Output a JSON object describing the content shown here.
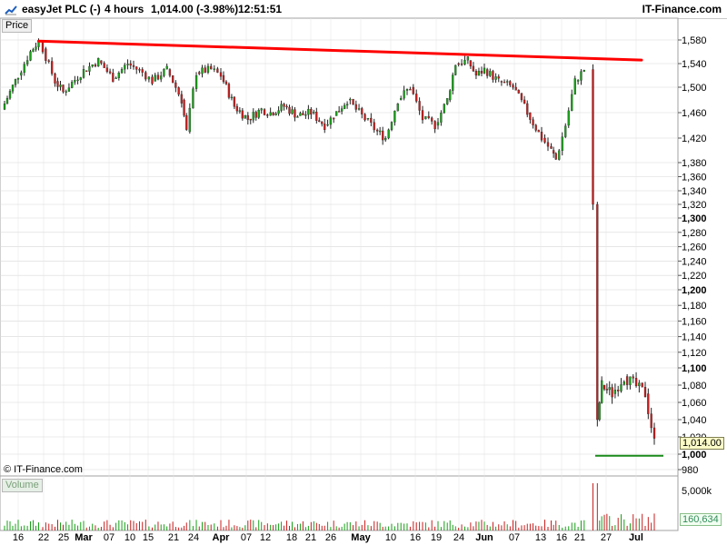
{
  "header": {
    "instrument": "easyJet PLC (-)",
    "timeframe": "4 hours",
    "quote": "1,014.00 (-3.98%)",
    "time": "12:51:51",
    "brand": "IT-Finance.com"
  },
  "labels": {
    "price_panel": "Price",
    "volume_panel": "Volume",
    "copyright": "© IT-Finance.com",
    "current_price": "1,014.00",
    "volume_scale_top": "5,000k",
    "current_volume": "160,634"
  },
  "colors": {
    "up": "#18a018",
    "down": "#c81e1e",
    "resistance": "#ff0000",
    "support": "#1a8a1a",
    "grid": "#d8d8d8",
    "text": "#000000"
  },
  "chart_data": {
    "type": "candlestick",
    "title": "easyJet PLC (-)",
    "timeframe": "4 hours",
    "y_axis": {
      "range": [
        975,
        1600
      ],
      "ticks": [
        980,
        1000,
        1020,
        1040,
        1060,
        1080,
        1100,
        1120,
        1140,
        1160,
        1180,
        1200,
        1220,
        1240,
        1260,
        1280,
        1300,
        1320,
        1340,
        1360,
        1380,
        1420,
        1460,
        1500,
        1540,
        1580
      ],
      "tick_labels": [
        "980",
        "1,000",
        "1,020",
        "1,040",
        "1,060",
        "1,080",
        "1,100",
        "1,120",
        "1,140",
        "1,160",
        "1,180",
        "1,200",
        "1,220",
        "1,240",
        "1,260",
        "1,280",
        "1,300",
        "1,320",
        "1,340",
        "1,360",
        "1,380",
        "1,420",
        "1,460",
        "1,500",
        "1,540",
        "1,580"
      ],
      "bold_ticks": [
        "1,000",
        "1,100",
        "1,200",
        "1,300"
      ]
    },
    "x_axis": {
      "tick_labels": [
        "16",
        "22",
        "25",
        "Mar",
        "07",
        "10",
        "15",
        "21",
        "24",
        "Apr",
        "07",
        "12",
        "18",
        "21",
        "26",
        "May",
        "10",
        "16",
        "19",
        "24",
        "Jun",
        "07",
        "13",
        "16",
        "21",
        "27",
        "Jul"
      ],
      "bold_ticks": [
        "Mar",
        "Apr",
        "May",
        "Jun",
        "Jul"
      ]
    },
    "price_path": [
      {
        "date": "Feb 14",
        "close": 1465
      },
      {
        "date": "Feb 16",
        "close": 1520
      },
      {
        "date": "Feb 19",
        "close": 1560
      },
      {
        "date": "Feb 21",
        "close": 1578
      },
      {
        "date": "Feb 22",
        "close": 1565
      },
      {
        "date": "Feb 25",
        "close": 1510
      },
      {
        "date": "Feb 27",
        "close": 1492
      },
      {
        "date": "Mar 01",
        "close": 1528
      },
      {
        "date": "Mar 04",
        "close": 1545
      },
      {
        "date": "Mar 07",
        "close": 1515
      },
      {
        "date": "Mar 10",
        "close": 1540
      },
      {
        "date": "Mar 13",
        "close": 1525
      },
      {
        "date": "Mar 15",
        "close": 1510
      },
      {
        "date": "Mar 18",
        "close": 1530
      },
      {
        "date": "Mar 21",
        "close": 1480
      },
      {
        "date": "Mar 22",
        "close": 1430
      },
      {
        "date": "Mar 24",
        "close": 1525
      },
      {
        "date": "Mar 27",
        "close": 1530
      },
      {
        "date": "Apr 01",
        "close": 1520
      },
      {
        "date": "Apr 04",
        "close": 1470
      },
      {
        "date": "Apr 07",
        "close": 1450
      },
      {
        "date": "Apr 10",
        "close": 1465
      },
      {
        "date": "Apr 12",
        "close": 1460
      },
      {
        "date": "Apr 15",
        "close": 1470
      },
      {
        "date": "Apr 18",
        "close": 1455
      },
      {
        "date": "Apr 21",
        "close": 1460
      },
      {
        "date": "Apr 24",
        "close": 1440
      },
      {
        "date": "Apr 26",
        "close": 1455
      },
      {
        "date": "Apr 29",
        "close": 1480
      },
      {
        "date": "May 02",
        "close": 1450
      },
      {
        "date": "May 05",
        "close": 1430
      },
      {
        "date": "May 07",
        "close": 1420
      },
      {
        "date": "May 10",
        "close": 1480
      },
      {
        "date": "May 13",
        "close": 1500
      },
      {
        "date": "May 16",
        "close": 1450
      },
      {
        "date": "May 19",
        "close": 1440
      },
      {
        "date": "May 22",
        "close": 1480
      },
      {
        "date": "May 24",
        "close": 1540
      },
      {
        "date": "May 27",
        "close": 1545
      },
      {
        "date": "May 29",
        "close": 1520
      },
      {
        "date": "Jun 01",
        "close": 1530
      },
      {
        "date": "Jun 04",
        "close": 1510
      },
      {
        "date": "Jun 07",
        "close": 1500
      },
      {
        "date": "Jun 10",
        "close": 1460
      },
      {
        "date": "Jun 13",
        "close": 1420
      },
      {
        "date": "Jun 15",
        "close": 1400
      },
      {
        "date": "Jun 16",
        "close": 1385
      },
      {
        "date": "Jun 18",
        "close": 1440
      },
      {
        "date": "Jun 20",
        "close": 1510
      },
      {
        "date": "Jun 22",
        "close": 1530
      },
      {
        "date": "Jun 24",
        "close": 1320
      },
      {
        "date": "Jun 25",
        "close": 1040
      },
      {
        "date": "Jun 26",
        "close": 1080
      },
      {
        "date": "Jun 28",
        "close": 1070
      },
      {
        "date": "Jun 30",
        "close": 1090
      },
      {
        "date": "Jul 02",
        "close": 1070
      },
      {
        "date": "Jul 03",
        "close": 1014
      }
    ],
    "resistance_line": {
      "start": {
        "date": "Feb 21",
        "value": 1578
      },
      "end": {
        "date": "Jul 03",
        "value": 1546
      }
    },
    "support_line": {
      "start": {
        "date": "Jun 25",
        "value": 998
      },
      "end": {
        "date": "Jul 04",
        "value": 998
      }
    },
    "volume": {
      "scale_label": "5,000k",
      "current": "160,634"
    }
  }
}
